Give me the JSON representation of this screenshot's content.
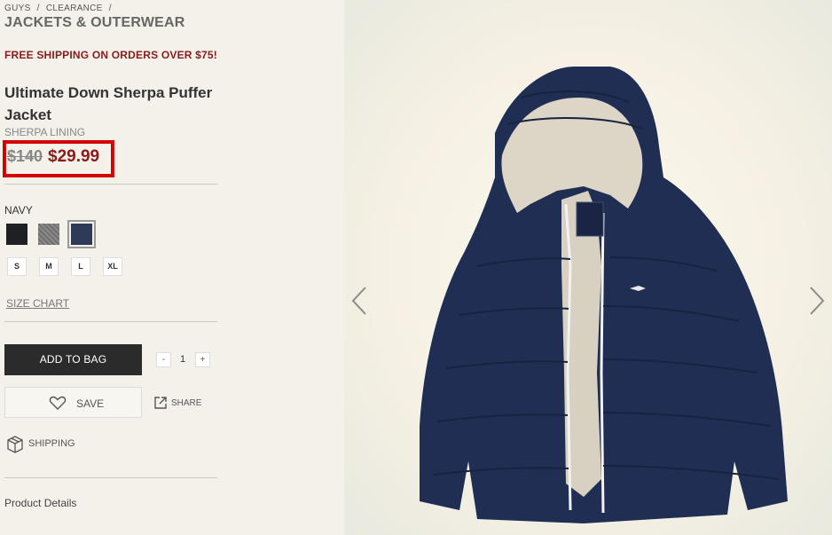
{
  "breadcrumb": {
    "items": [
      "GUYS",
      "/",
      "CLEARANCE",
      "/"
    ],
    "current": "JACKETS & OUTERWEAR"
  },
  "promo": "FREE SHIPPING ON ORDERS OVER $75!",
  "product": {
    "title": "Ultimate Down Sherpa Puffer Jacket",
    "subtitle": "SHERPA LINING",
    "old_price": "$140",
    "new_price": "$29.99",
    "selected_color": "NAVY",
    "colors": [
      "#1f2024",
      "#7a7a7a",
      "#2e3a57"
    ],
    "sizes": [
      "S",
      "M",
      "L",
      "XL"
    ],
    "size_chart": "SIZE CHART",
    "add_to_bag": "ADD TO BAG",
    "quantity": "1",
    "qty_minus": "-",
    "qty_plus": "+",
    "save": "SAVE",
    "share": "SHARE",
    "shipping": "SHIPPING",
    "details_heading": "Product Details"
  },
  "colors": {
    "price_red": "#8b1a1a",
    "highlight_red": "#d50000",
    "jacket_navy": "#1f2e52"
  },
  "icons": [
    "heart-icon",
    "share-icon",
    "shipping-box-icon",
    "chevron-left-icon",
    "chevron-right-icon"
  ]
}
